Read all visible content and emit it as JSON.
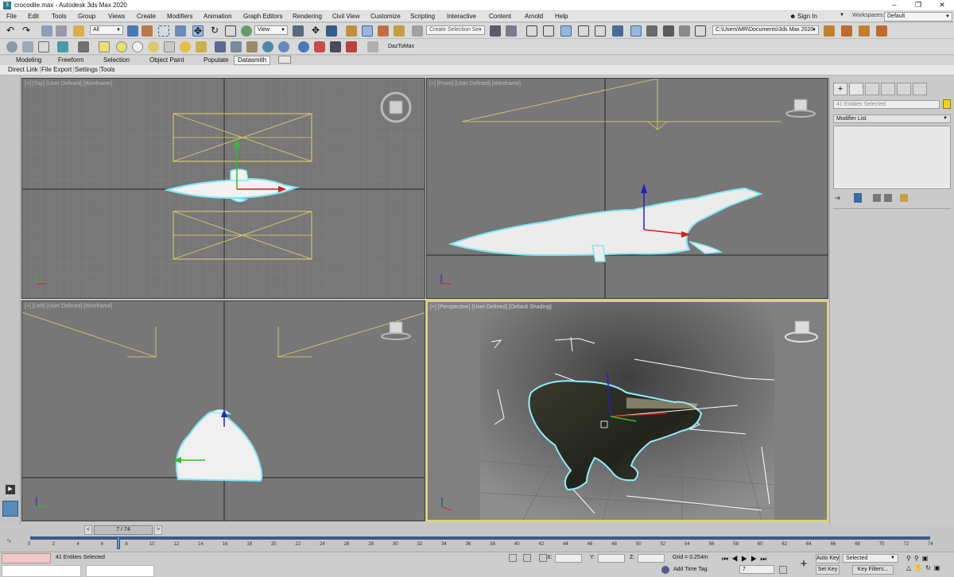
{
  "window": {
    "title": "crocodile.max - Autodesk 3ds Max 2020",
    "app_icon": "3ds-max-icon"
  },
  "menus": [
    "File",
    "Edit",
    "Tools",
    "Group",
    "Views",
    "Create",
    "Modifiers",
    "Animation",
    "Graph Editors",
    "Rendering",
    "Civil View",
    "Customize",
    "Scripting",
    "Interactive",
    "Content",
    "Arnold",
    "Help"
  ],
  "account": {
    "sign_in": "Sign In",
    "workspaces_label": "Workspaces:",
    "workspace_value": "Default"
  },
  "toolbar": {
    "filter_value": "All",
    "coord_value": "View",
    "selection_set_placeholder": "Create Selection Se",
    "project_path": "C:\\Users\\MR\\Documents\\3ds Max 2020",
    "daz_label": "DazToMax"
  },
  "ribbon_tabs": [
    "Modeling",
    "Freeform",
    "Selection",
    "Object Paint",
    "Populate",
    "Datasmith"
  ],
  "sub_tabs": [
    "Direct Link",
    "File Export",
    "Settings",
    "Tools"
  ],
  "viewports": {
    "top": {
      "label": "[+] [Top] [User Defined] [Wireframe]"
    },
    "front": {
      "label": "[+] [Front] [User Defined] [Wireframe]"
    },
    "left": {
      "label": "[+] [Left] [User Defined] [Wireframe]"
    },
    "perspective": {
      "label": "[+] [Perspective] [User Defined] [Default Shading]"
    }
  },
  "command_panel": {
    "entities": "41 Entities Selected",
    "modifier_list": "Modifier List"
  },
  "timeline": {
    "frame_counter": "7 / 74",
    "ticks": [
      "0",
      "2",
      "4",
      "6",
      "8",
      "10",
      "12",
      "14",
      "16",
      "18",
      "20",
      "22",
      "24",
      "26",
      "28",
      "30",
      "32",
      "34",
      "36",
      "38",
      "40",
      "42",
      "44",
      "46",
      "48",
      "50",
      "52",
      "54",
      "56",
      "58",
      "60",
      "62",
      "64",
      "66",
      "68",
      "70",
      "72",
      "74"
    ]
  },
  "status": {
    "selected_text": "41 Entities Selected",
    "x_label": "X:",
    "y_label": "Y:",
    "z_label": "Z:",
    "grid_text": "Grid = 0.254m",
    "add_time_tag": "Add Time Tag",
    "auto_key": "Auto Key",
    "set_key": "Set Key",
    "selected_dropdown": "Selected",
    "key_filters": "Key Filters...",
    "frame_value": "7"
  },
  "colors": {
    "selection_yellow": "#e2d36a",
    "wire_white": "#ffffff",
    "viewport_gray": "#777777",
    "selection_cyan": "#7fe6f2"
  }
}
